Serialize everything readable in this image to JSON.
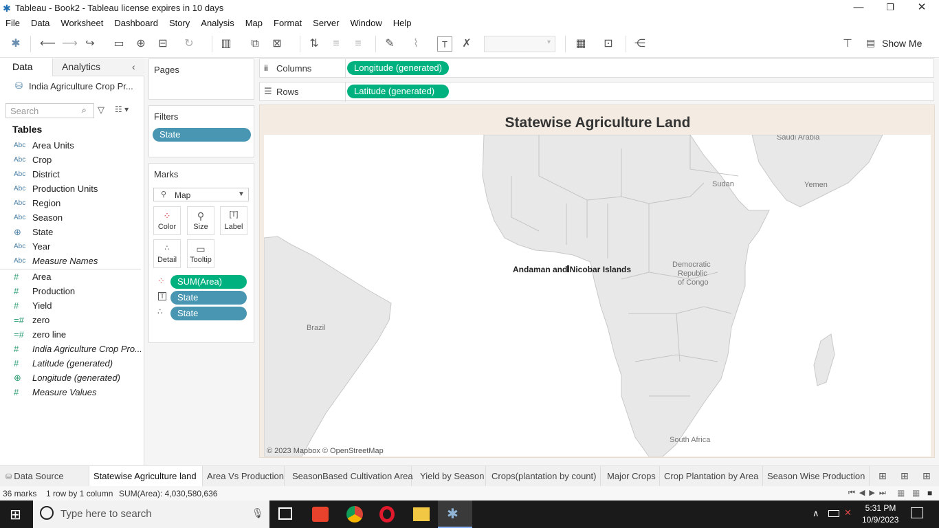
{
  "window": {
    "title": "Tableau - Book2 - Tableau license expires in 10 days",
    "min": "—",
    "max": "❐",
    "close": "✕"
  },
  "menu": [
    "File",
    "Data",
    "Worksheet",
    "Dashboard",
    "Story",
    "Analysis",
    "Map",
    "Format",
    "Server",
    "Window",
    "Help"
  ],
  "toolbar": {
    "show_me": "Show Me"
  },
  "left": {
    "tab_data": "Data",
    "tab_analytics": "Analytics",
    "datasource": "India Agriculture Crop Pr...",
    "search_placeholder": "Search",
    "tables_header": "Tables",
    "dimensions": [
      {
        "type": "Abc",
        "name": "Area Units"
      },
      {
        "type": "Abc",
        "name": "Crop"
      },
      {
        "type": "Abc",
        "name": "District"
      },
      {
        "type": "Abc",
        "name": "Production Units"
      },
      {
        "type": "Abc",
        "name": "Region"
      },
      {
        "type": "Abc",
        "name": "Season"
      },
      {
        "type": "globe",
        "name": "State"
      },
      {
        "type": "Abc",
        "name": "Year"
      },
      {
        "type": "Abc",
        "name": "Measure Names"
      }
    ],
    "measures": [
      {
        "type": "#",
        "name": "Area"
      },
      {
        "type": "#",
        "name": "Production"
      },
      {
        "type": "#",
        "name": "Yield"
      },
      {
        "type": "=#",
        "name": "zero"
      },
      {
        "type": "=#",
        "name": "zero line"
      },
      {
        "type": "#",
        "name": "India Agriculture Crop Pro..."
      },
      {
        "type": "globe",
        "name": "Latitude (generated)"
      },
      {
        "type": "globe",
        "name": "Longitude (generated)"
      },
      {
        "type": "#",
        "name": "Measure Values"
      }
    ]
  },
  "cards": {
    "pages": "Pages",
    "filters": "Filters",
    "filter_pill": "State",
    "marks": "Marks",
    "mark_type": "Map",
    "color": "Color",
    "size": "Size",
    "label": "Label",
    "detail": "Detail",
    "tooltip": "Tooltip",
    "mark_pills": [
      "SUM(Area)",
      "State",
      "State"
    ]
  },
  "shelves": {
    "columns_label": "Columns",
    "columns_pill": "Longitude (generated)",
    "rows_label": "Rows",
    "rows_pill": "Latitude (generated)"
  },
  "viz": {
    "title": "Statewise Agriculture Land",
    "mark_label": "Andaman and Nicobar Islands",
    "attribution": "© 2023 Mapbox © OpenStreetMap",
    "places": {
      "saudi": "Saudi Arabia",
      "yemen": "Yemen",
      "sudan": "Sudan",
      "drc_1": "Democratic",
      "drc_2": "Republic",
      "drc_3": "of Congo",
      "brazil": "Brazil",
      "south_africa": "South Africa"
    }
  },
  "sheets": [
    {
      "label": "Data Source",
      "active": false
    },
    {
      "label": "Statewise Agriculture land",
      "active": true
    },
    {
      "label": "Area Vs Production",
      "active": false
    },
    {
      "label": "SeasonBased Cultivation Area",
      "active": false
    },
    {
      "label": "Yield by Season",
      "active": false
    },
    {
      "label": "Crops(plantation by count)",
      "active": false
    },
    {
      "label": "Major Crops",
      "active": false
    },
    {
      "label": "Crop Plantation by Area",
      "active": false
    },
    {
      "label": "Season Wise Production",
      "active": false
    }
  ],
  "status": {
    "marks": "36 marks",
    "rows_cols": "1 row by 1 column",
    "sum": "SUM(Area): 4,030,580,636"
  },
  "taskbar": {
    "search_placeholder": "Type here to search",
    "time": "5:31 PM",
    "date": "10/9/2023"
  }
}
